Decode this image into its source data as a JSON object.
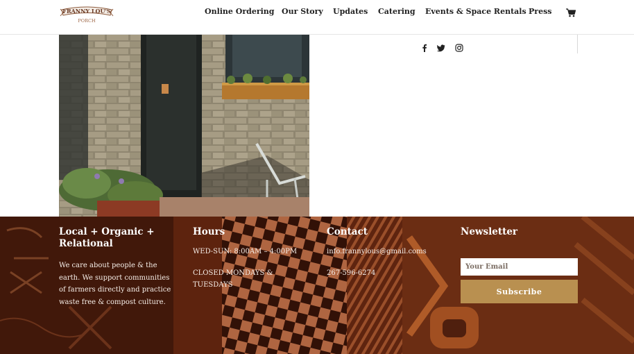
{
  "brand": {
    "logo_text": "FRANNY LOU'S",
    "logo_sub": "PORCH"
  },
  "nav": {
    "items": [
      {
        "label": "Online Ordering"
      },
      {
        "label": "Our Story"
      },
      {
        "label": "Updates"
      },
      {
        "label": "Catering"
      },
      {
        "label": "Events & Space Rentals"
      },
      {
        "label": "Press"
      }
    ],
    "cart_icon": "shopping-cart-icon"
  },
  "social": [
    "facebook-icon",
    "twitter-icon",
    "instagram-icon"
  ],
  "footer": {
    "about": {
      "heading": "Local + Organic + Relational",
      "text": "We care about people & the earth. We support communities of farmers directly and practice waste free & compost culture."
    },
    "hours": {
      "heading": "Hours",
      "line1": "WED-SUN: 8:00AM – 4:00PM",
      "line2": "CLOSED MONDAYS & TUESDAYS"
    },
    "contact": {
      "heading": "Contact",
      "email": "info.frannylous@gmail.coms",
      "phone": "267-596-6274"
    },
    "newsletter": {
      "heading": "Newsletter",
      "email_placeholder": "Your Email",
      "subscribe_label": "Subscribe"
    }
  },
  "colors": {
    "footer_bg": "#5a2410",
    "accent_gold": "#b99050"
  }
}
